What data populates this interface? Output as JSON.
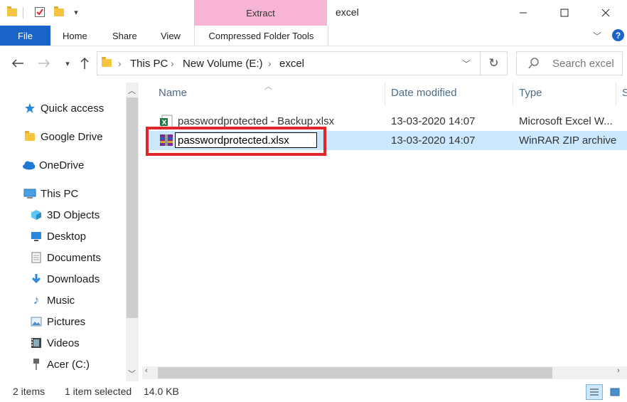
{
  "window": {
    "title": "excel",
    "context_group": "Extract",
    "minimize_icon": "minimize-icon",
    "maximize_icon": "maximize-icon",
    "close_icon": "close-icon"
  },
  "ribbon": {
    "file": "File",
    "tabs": [
      "Home",
      "Share",
      "View"
    ],
    "context_tab": "Compressed Folder Tools"
  },
  "address": {
    "crumbs": [
      "This PC",
      "New Volume (E:)",
      "excel"
    ],
    "search_placeholder": "Search excel"
  },
  "nav": {
    "items": [
      {
        "label": "Quick access",
        "icon": "star-icon"
      },
      {
        "label": "Google Drive",
        "icon": "folder-icon"
      },
      {
        "label": "OneDrive",
        "icon": "cloud-icon"
      },
      {
        "label": "This PC",
        "icon": "computer-icon"
      },
      {
        "label": "3D Objects",
        "icon": "cube-icon"
      },
      {
        "label": "Desktop",
        "icon": "desktop-icon"
      },
      {
        "label": "Documents",
        "icon": "document-icon"
      },
      {
        "label": "Downloads",
        "icon": "download-icon"
      },
      {
        "label": "Music",
        "icon": "music-icon"
      },
      {
        "label": "Pictures",
        "icon": "picture-icon"
      },
      {
        "label": "Videos",
        "icon": "video-icon"
      },
      {
        "label": "Acer (C:)",
        "icon": "drive-icon"
      }
    ]
  },
  "columns": {
    "name": "Name",
    "date": "Date modified",
    "type": "Type",
    "size": "S"
  },
  "files": [
    {
      "name": "passwordprotected - Backup.xlsx",
      "date": "13-03-2020 14:07",
      "type": "Microsoft Excel W...",
      "icon": "excel-file-icon"
    },
    {
      "name": "passwordprotected.xlsx",
      "date": "13-03-2020 14:07",
      "type": "WinRAR ZIP archive",
      "icon": "winrar-archive-icon",
      "selected": true,
      "renaming": true
    }
  ],
  "status": {
    "count": "2 items",
    "selection": "1 item selected",
    "size": "14.0 KB"
  },
  "colors": {
    "file_tab": "#1a64c8",
    "context_tab": "#f7b5d3",
    "selection": "#cce8ff",
    "highlight_box": "#e0262a"
  }
}
